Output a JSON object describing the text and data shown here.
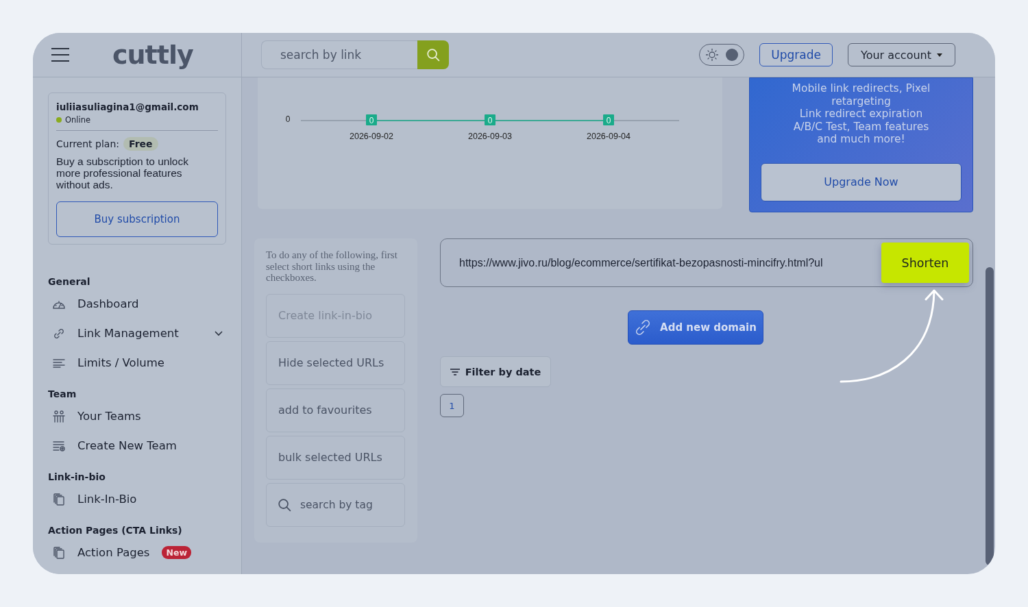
{
  "header": {
    "logo": "cuttly",
    "search": {
      "placeholder": "search by link"
    },
    "theme_toggle": {
      "on": true
    },
    "upgrade_button": "Upgrade",
    "account_menu": "Your account"
  },
  "sidebar": {
    "account": {
      "email": "iuliiasuliagina1@gmail.com",
      "status": "Online",
      "plan_label": "Current plan:",
      "plan": "Free",
      "message": "Buy a subscription to unlock more professional features without ads.",
      "button": "Buy subscription"
    },
    "sections": [
      {
        "title": "General",
        "items": [
          {
            "label": "Dashboard"
          },
          {
            "label": "Link Management",
            "expanded": false
          },
          {
            "label": "Limits / Volume"
          }
        ]
      },
      {
        "title": "Team",
        "items": [
          {
            "label": "Your Teams"
          },
          {
            "label": "Create New Team"
          }
        ]
      },
      {
        "title": "Link-in-bio",
        "items": [
          {
            "label": "Link-In-Bio"
          }
        ]
      },
      {
        "title": "Action Pages (CTA Links)",
        "items": [
          {
            "label": "Action Pages",
            "badge": "New"
          }
        ]
      }
    ]
  },
  "chart": {
    "axis_value": "0",
    "dates": [
      "2026-09-02",
      "2026-09-03",
      "2026-09-04"
    ],
    "point_labels": [
      "0",
      "0",
      "0"
    ]
  },
  "promo": {
    "lines": [
      "Mobile link redirects, Pixel retargeting",
      "Link redirect expiration",
      "A/B/C Test, Team features",
      "and much more!"
    ],
    "button": "Upgrade Now"
  },
  "bulk_panel": {
    "hint": "To do any of the following, first select short links using the checkboxes.",
    "actions": [
      {
        "kind": "button",
        "label": "Create link-in-bio",
        "disabled": true
      },
      {
        "kind": "button",
        "label": "Hide selected URLs",
        "disabled": false
      },
      {
        "kind": "button",
        "label": "add to favourites",
        "disabled": false
      },
      {
        "kind": "button",
        "label": "bulk selected URLs",
        "disabled": false
      },
      {
        "kind": "search",
        "placeholder": "search by tag"
      }
    ]
  },
  "shorten": {
    "value": "https://www.jivo.ru/blog/ecommerce/sertifikat-bezopasnosti-mincifry.html?ul",
    "button": "Shorten"
  },
  "add_domain_button": "Add new domain",
  "filter_button": "Filter by date",
  "pagination": [
    {
      "label": "1",
      "selected": true
    }
  ]
}
